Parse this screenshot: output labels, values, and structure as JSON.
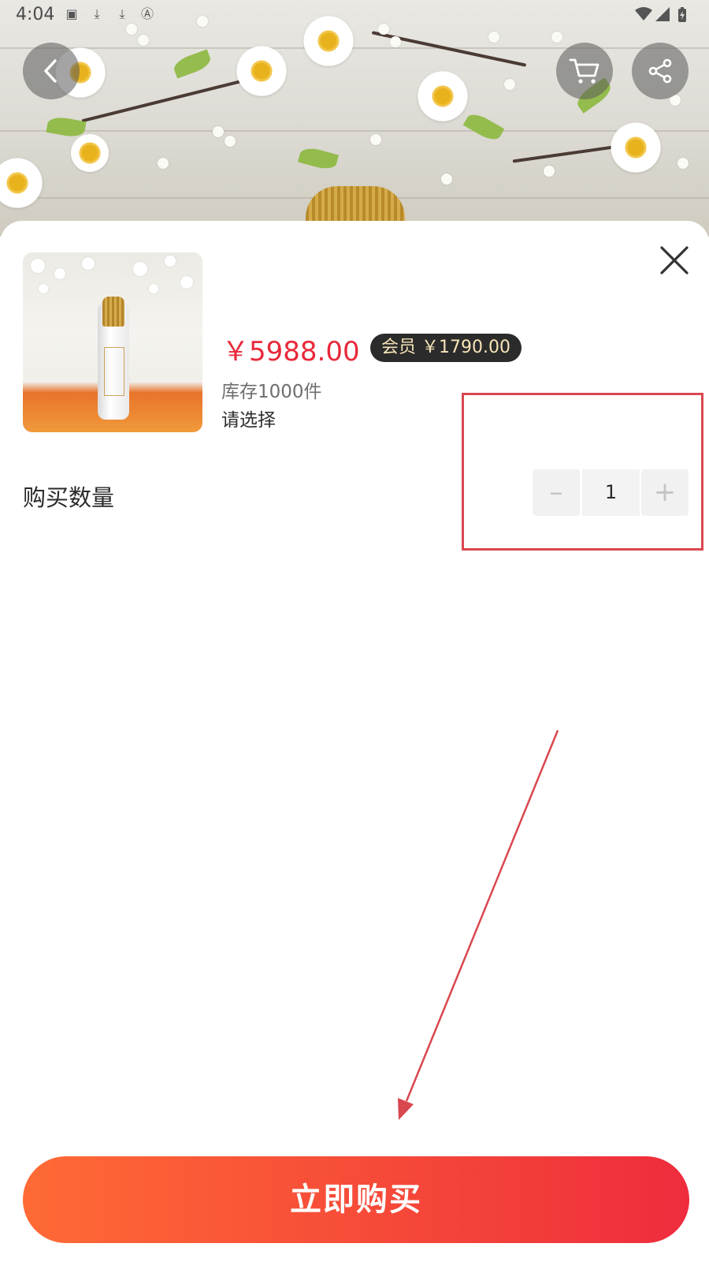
{
  "status_bar": {
    "time": "4:04",
    "icons": [
      "image-icon",
      "download-icon",
      "download-icon",
      "text-icon",
      "wifi-icon",
      "signal-icon",
      "battery-icon"
    ]
  },
  "header": {
    "back_icon": "chevron-left-icon",
    "cart_icon": "cart-icon",
    "share_icon": "share-icon"
  },
  "product": {
    "price": "￥5988.00",
    "member_price": "会员  ￥1790.00",
    "stock": "库存1000件",
    "select_prompt": "请选择"
  },
  "quantity": {
    "label": "购买数量",
    "value": "1",
    "minus": "–",
    "plus": "+"
  },
  "actions": {
    "buy_now": "立即购买"
  },
  "colors": {
    "price": "#e8283a",
    "buy_gradient_start": "#ff6a35",
    "buy_gradient_end": "#ee2c3d",
    "annotation": "#d9474f"
  }
}
